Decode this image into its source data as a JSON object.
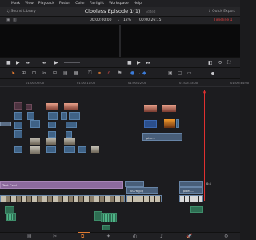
{
  "menu": [
    "",
    "Mark",
    "View",
    "Playback",
    "Fusion",
    "Color",
    "Fairlight",
    "Workspace",
    "Help"
  ],
  "title_bar": {
    "media_library": "Sound Library",
    "project_title": "Clooless Episode 1(1)",
    "edited": "Edited",
    "quick_export": "Quick Export"
  },
  "viewer_header": {
    "timecode_left": "00:00:00:00",
    "zoom": "12%",
    "timecode_right": "00:00:26:15",
    "timeline_name": "Timeline 1"
  },
  "ruler": {
    "ticks": [
      "01:00:00:00",
      "01:00:11:00",
      "01:00:22:00",
      "01:00:33:00",
      "01:00:44:00"
    ]
  },
  "clip_labels": {
    "title": "Text Card",
    "clip_0076": "0076.jpg",
    "pixel": "pixel-...",
    "pixel_upper": "pixe...",
    "a1": "0:4"
  },
  "icons": {
    "transport": [
      "skip-start-icon",
      "prev-frame-icon",
      "stop-icon",
      "play-icon",
      "next-frame-icon",
      "skip-end-icon",
      "loop-icon"
    ],
    "toolbar": [
      "pointer-icon",
      "trim-icon",
      "blade-icon",
      "link-icon",
      "snapping-icon",
      "flag-icon",
      "marker-icon"
    ],
    "pages": [
      "media-page-icon",
      "cut-page-icon",
      "edit-page-icon",
      "fusion-page-icon",
      "color-page-icon",
      "fairlight-page-icon",
      "deliver-page-icon"
    ]
  },
  "colors": {
    "accent": "#e07a30",
    "playhead": "#e03030",
    "video_clip": "#3f6286",
    "audio_clip": "#2e6d52",
    "title_clip": "#8c6a9d"
  }
}
